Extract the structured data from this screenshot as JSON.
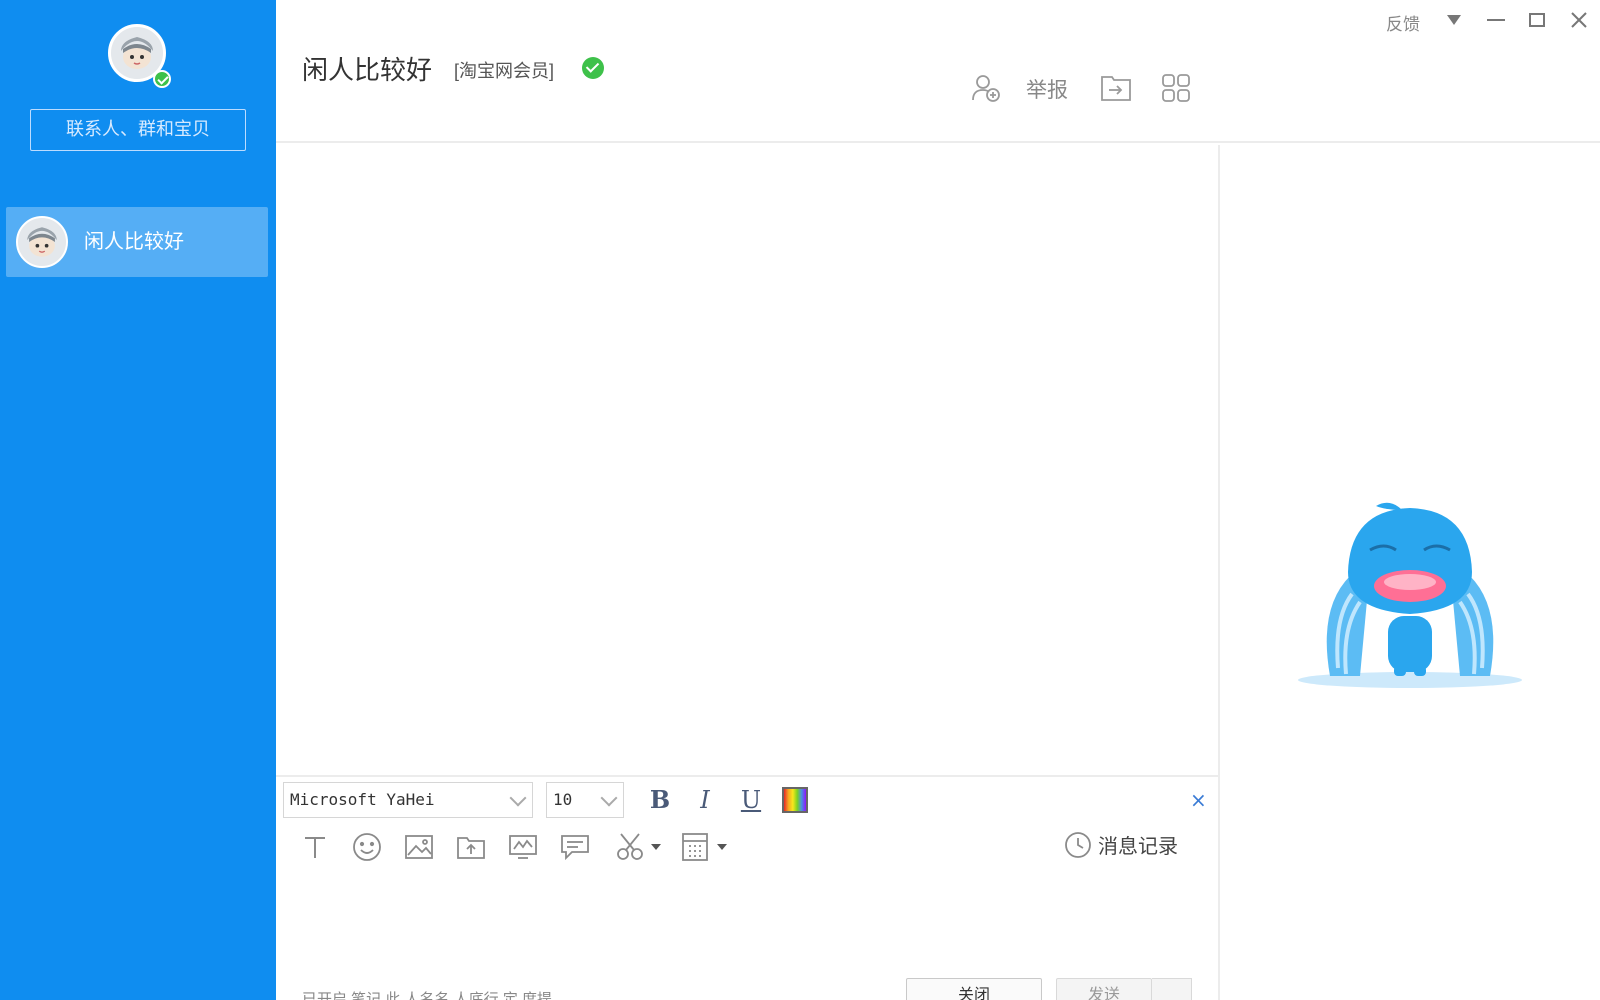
{
  "window": {
    "feedback_label": "反馈",
    "controls": [
      "dropdown-icon",
      "minimize-icon",
      "maximize-icon",
      "close-icon"
    ]
  },
  "sidebar": {
    "search_placeholder": "联系人、群和宝贝",
    "contacts": [
      {
        "name": "闲人比较好",
        "selected": true
      }
    ],
    "accent_color": "#0f8df0",
    "selected_color": "#55aef5"
  },
  "header": {
    "chat_name": "闲人比较好",
    "member_tag": "[淘宝网会员]",
    "verified": true,
    "actions": {
      "add_contact_icon": "add-contact-icon",
      "report_label": "举报",
      "transfer_icon": "transfer-icon",
      "apps_icon": "apps-grid-icon"
    }
  },
  "editor": {
    "font_name": "Microsoft YaHei",
    "font_size": "10",
    "bold_label": "B",
    "italic_label": "I",
    "underline_label": "U",
    "close_symbol": "×",
    "tools": [
      "text-format-icon",
      "emoji-icon",
      "image-icon",
      "file-icon",
      "screenshot-icon",
      "comment-icon",
      "scissors-icon",
      "calculator-icon"
    ],
    "history_label": "消息记录"
  },
  "footer": {
    "hint_text": "已开启  笔记  此  人名名  人底行  定  度提",
    "close_button": "关闭",
    "send_button": "发送"
  }
}
